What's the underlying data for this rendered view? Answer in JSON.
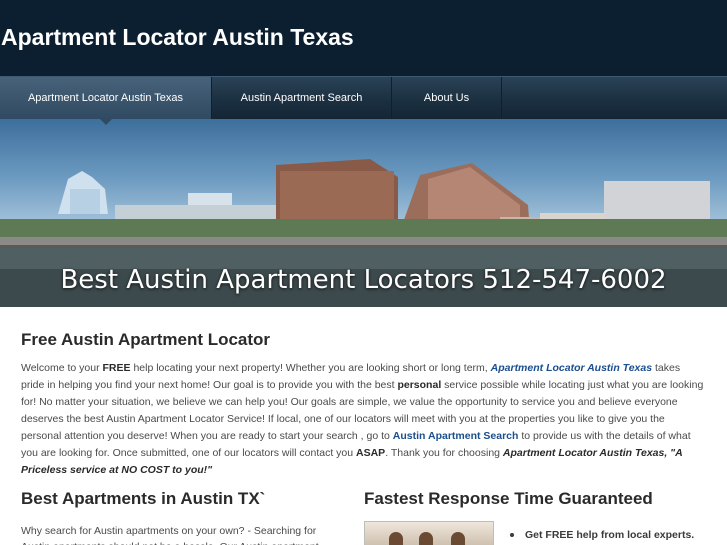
{
  "header": {
    "title": "Apartment Locator Austin Texas"
  },
  "nav": {
    "items": [
      {
        "label": "Apartment Locator Austin Texas",
        "active": true
      },
      {
        "label": "Austin Apartment Search",
        "active": false
      },
      {
        "label": "About Us",
        "active": false
      }
    ]
  },
  "banner": {
    "caption": "Best Austin Apartment Locators 512-547-6002"
  },
  "main": {
    "heading": "Free Austin Apartment Locator",
    "intro": {
      "p1": "Welcome to your ",
      "free": "FREE",
      "p2": " help locating your next property! Whether you are looking short or long term, ",
      "link1": "Apartment Locator Austin Texas",
      "p3": " takes pride in helping you find your next home! Our goal is to provide you with the best ",
      "personal": "personal",
      "p4": " service possible while locating just what you are looking for! No matter your situation, we believe we can help you! Our goals are simple, we value the opportunity to service you and believe everyone deserves the best Austin Apartment Locator Service! If local, one of our locators will meet with you at the properties you like to give you the personal attention you deserve! When you are ready to start your search , go to ",
      "link2": "Austin Apartment Search",
      "p5": " to provide us with the details of what you are looking for. Once submitted, one of our locators will contact you ",
      "asap": "ASAP",
      "p6": ". Thank you for choosing ",
      "brand": "Apartment Locator Austin Texas, \"A Priceless service at NO COST to you!\""
    }
  },
  "left_section": {
    "heading": "Best Apartments in Austin TX`",
    "text": "Why search for Austin apartments on your own? - Searching for Austin apartments should not be a hassle. Our Austin apartment locators are"
  },
  "right_section": {
    "heading": "Fastest Response Time Guaranteed",
    "bullets": [
      "Get FREE help from local experts."
    ]
  }
}
